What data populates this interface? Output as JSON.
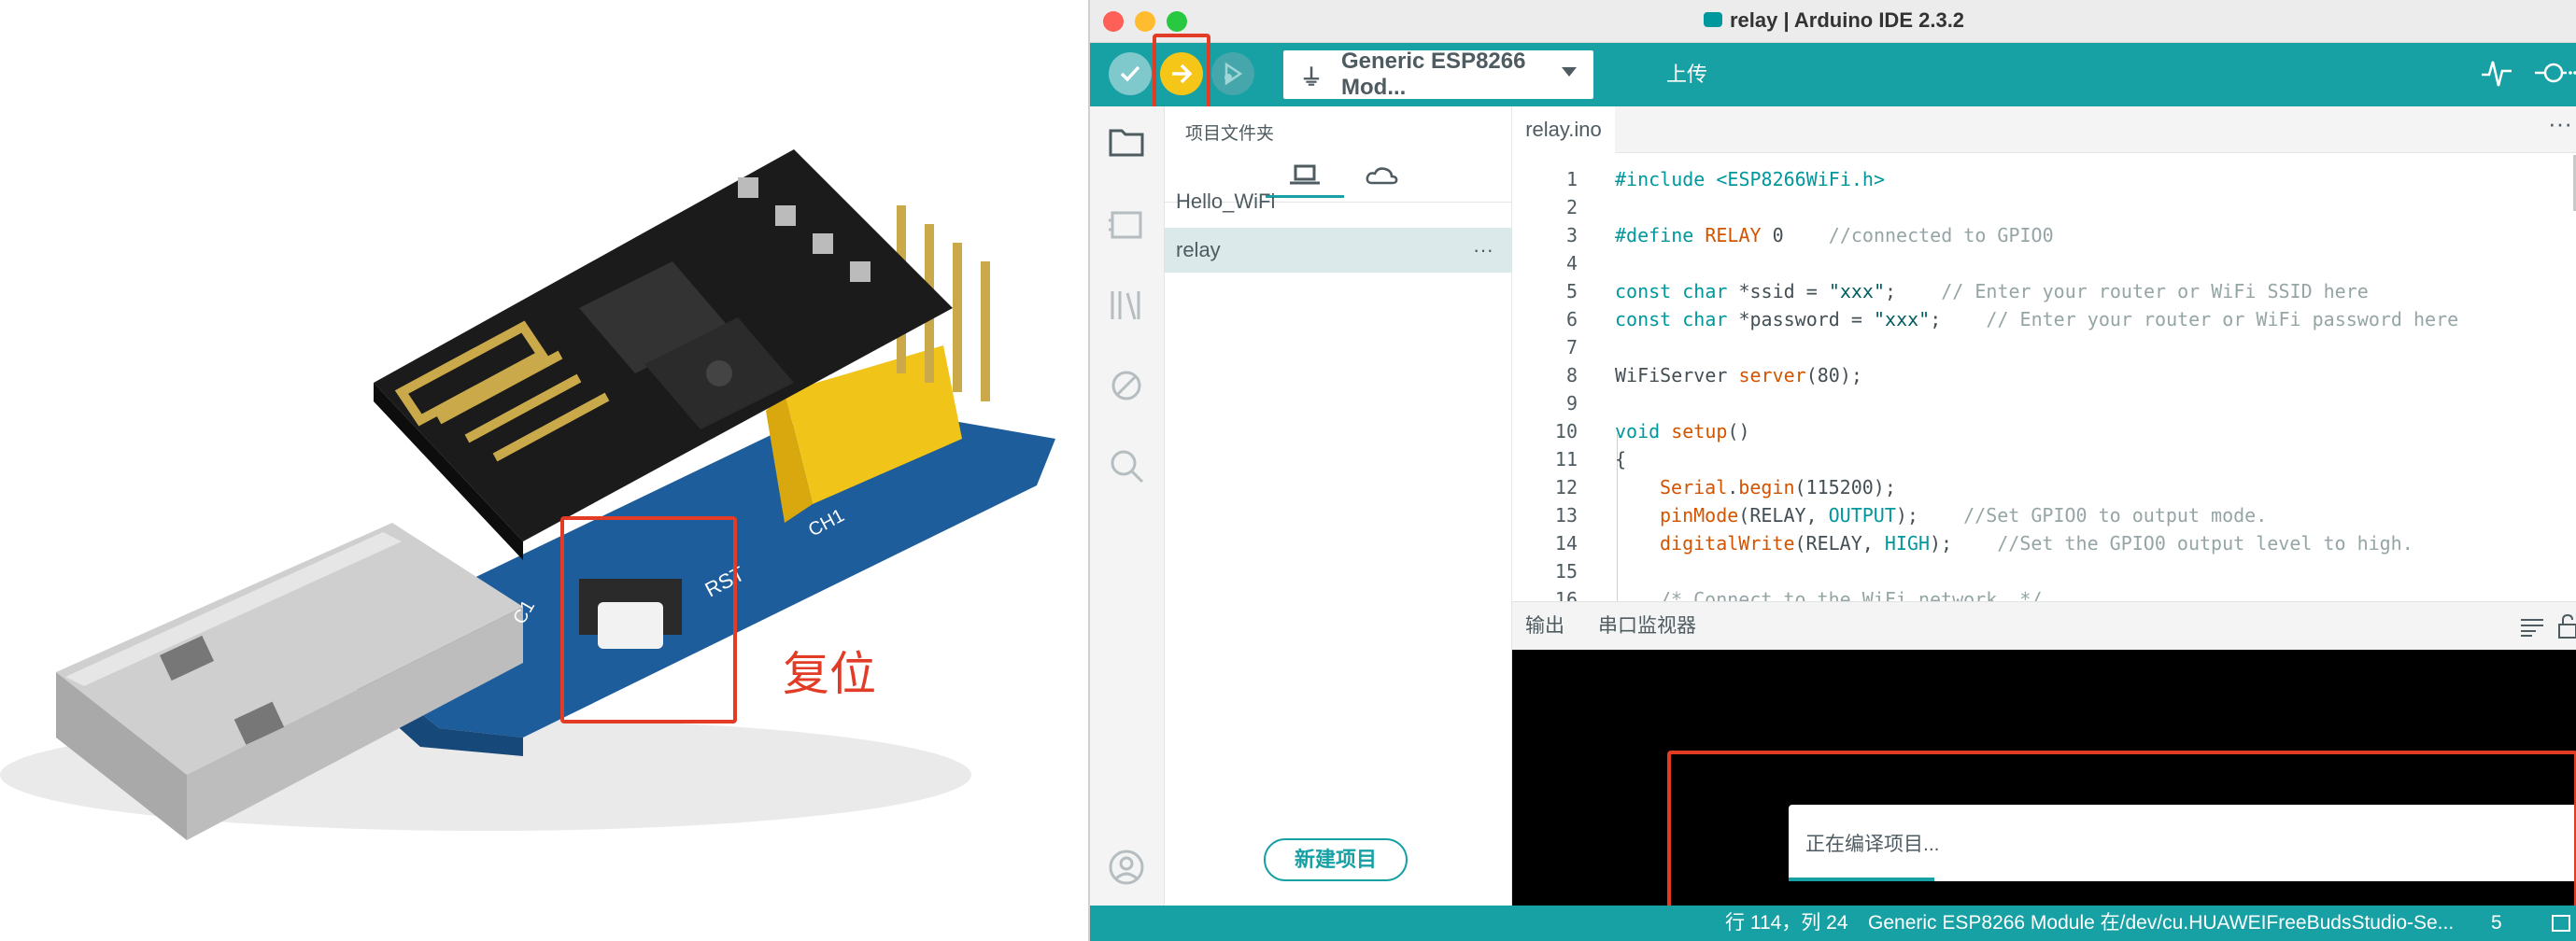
{
  "photo": {
    "annotation_label": "复位",
    "board_labels": [
      "RST",
      "CH1",
      "C1"
    ]
  },
  "window": {
    "title": "relay | Arduino IDE 2.3.2"
  },
  "toolbar": {
    "verify_icon": "check-icon",
    "upload_icon": "arrow-right-icon",
    "debug_icon": "debug-icon",
    "board": "Generic ESP8266 Mod...",
    "upload_label": "上传"
  },
  "sidebar": {
    "title": "项目文件夹",
    "items": [
      {
        "label": "Hello_WiFi"
      },
      {
        "label": "relay",
        "more": "···"
      }
    ],
    "new_sketch": "新建项目"
  },
  "editor": {
    "tab": "relay.ino",
    "tab_more": "···",
    "line_numbers": [
      "1",
      "2",
      "3",
      "4",
      "5",
      "6",
      "7",
      "8",
      "9",
      "10",
      "11",
      "12",
      "13",
      "14",
      "15",
      "16"
    ],
    "code": {
      "l1": [
        "#include <ESP8266WiFi.h>"
      ],
      "l3": [
        "#define ",
        "RELAY",
        " 0",
        "    //connected to GPIO0"
      ],
      "l5": [
        "const",
        " ",
        "char",
        " *ssid = ",
        "\"xxx\"",
        ";    ",
        "// Enter your router or WiFi SSID here"
      ],
      "l6": [
        "const",
        " ",
        "char",
        " *password = ",
        "\"xxx\"",
        ";    ",
        "// Enter your router or WiFi password here"
      ],
      "l8": [
        "WiFiServer",
        " ",
        "server",
        "(80);"
      ],
      "l10": [
        "void",
        " ",
        "setup",
        "()"
      ],
      "l11": [
        "{"
      ],
      "l12": [
        "Serial",
        ".",
        "begin",
        "(115200);"
      ],
      "l13": [
        "pinMode",
        "(RELAY, ",
        "OUTPUT",
        ");    ",
        "//Set GPIO0 to output mode."
      ],
      "l14": [
        "digitalWrite",
        "(RELAY, ",
        "HIGH",
        ");    ",
        "//Set the GPIO0 output level to high."
      ],
      "l16": [
        "/* Connect to the WiFi network. */"
      ]
    }
  },
  "panel": {
    "tabs": [
      "输出",
      "串口监视器"
    ],
    "notification": "正在编译项目..."
  },
  "status": {
    "position": "行 114，列 24",
    "board": "Generic ESP8266 Module 在/dev/cu.HUAWEIFreeBudsStudio-Se...",
    "count": "5"
  },
  "colors": {
    "teal": "#17a1a5",
    "upload": "#f5c517",
    "annotation": "#e23b26"
  }
}
